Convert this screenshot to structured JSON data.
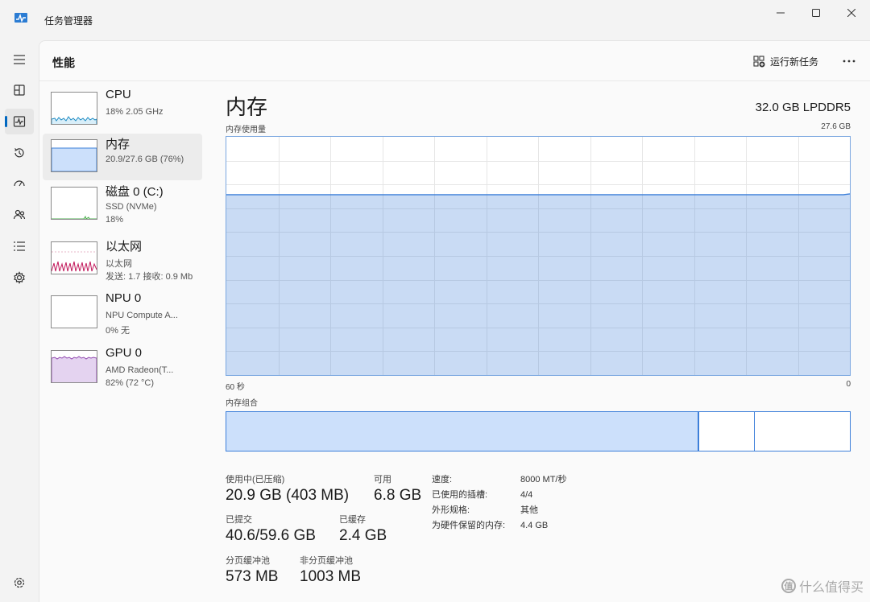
{
  "window": {
    "title": "任务管理器",
    "icons": [
      "task-manager-icon",
      "minimize-icon",
      "maximize-icon",
      "close-icon"
    ]
  },
  "nav": {
    "items": [
      {
        "name": "hamburger-menu",
        "icon": "hamburger-icon"
      },
      {
        "name": "processes",
        "icon": "processes-icon"
      },
      {
        "name": "performance",
        "icon": "performance-icon",
        "active": true
      },
      {
        "name": "app-history",
        "icon": "history-icon"
      },
      {
        "name": "startup-apps",
        "icon": "startup-icon"
      },
      {
        "name": "users",
        "icon": "users-icon"
      },
      {
        "name": "details",
        "icon": "details-icon"
      },
      {
        "name": "services",
        "icon": "services-icon"
      },
      {
        "name": "settings",
        "icon": "settings-icon"
      }
    ]
  },
  "header": {
    "title": "性能",
    "run_new_task": "运行新任务",
    "more_label": "..."
  },
  "sidebar": {
    "items": [
      {
        "name": "CPU",
        "sub1": "18%  2.05 GHz",
        "sub2": ""
      },
      {
        "name": "内存",
        "sub1": "20.9/27.6 GB (76%)",
        "sub2": "",
        "selected": true
      },
      {
        "name": "磁盘 0 (C:)",
        "sub1": "SSD (NVMe)",
        "sub2": "18%"
      },
      {
        "name": "以太网",
        "sub1": "以太网",
        "sub2": "发送: 1.7  接收: 0.9 Mb"
      },
      {
        "name": "NPU 0",
        "sub1": "NPU Compute A...",
        "sub2": "0%  无"
      },
      {
        "name": "GPU 0",
        "sub1": "AMD Radeon(T...",
        "sub2": "82%  (72 °C)"
      }
    ],
    "colors": {
      "cpu": "#1e8bc3",
      "memory": "#3d7fd9",
      "disk": "#4caf50",
      "ethernet": "#c2185b",
      "gpu": "#8e44ad"
    }
  },
  "memory": {
    "title": "内存",
    "spec": "32.0 GB LPDDR5",
    "usage_label": "内存使用量",
    "usage_max": "27.6 GB",
    "usage_fraction": 0.757,
    "axis_left": "60 秒",
    "axis_right": "0",
    "composition_label": "内存组合",
    "in_use_label": "使用中(已压缩)",
    "in_use_value": "20.9 GB (403 MB)",
    "available_label": "可用",
    "available_value": "6.8 GB",
    "committed_label": "已提交",
    "committed_value": "40.6/59.6 GB",
    "cached_label": "已缓存",
    "cached_value": "2.4 GB",
    "paged_label": "分页缓冲池",
    "paged_value": "573 MB",
    "nonpaged_label": "非分页缓冲池",
    "nonpaged_value": "1003 MB",
    "details": [
      {
        "key": "速度:",
        "value": "8000 MT/秒"
      },
      {
        "key": "已使用的插槽:",
        "value": "4/4"
      },
      {
        "key": "外形规格:",
        "value": "其他"
      },
      {
        "key": "为硬件保留的内存:",
        "value": "4.4 GB"
      }
    ]
  },
  "watermark": {
    "logo": "值",
    "text": "什么值得买"
  },
  "accent_color": "#0067c0"
}
